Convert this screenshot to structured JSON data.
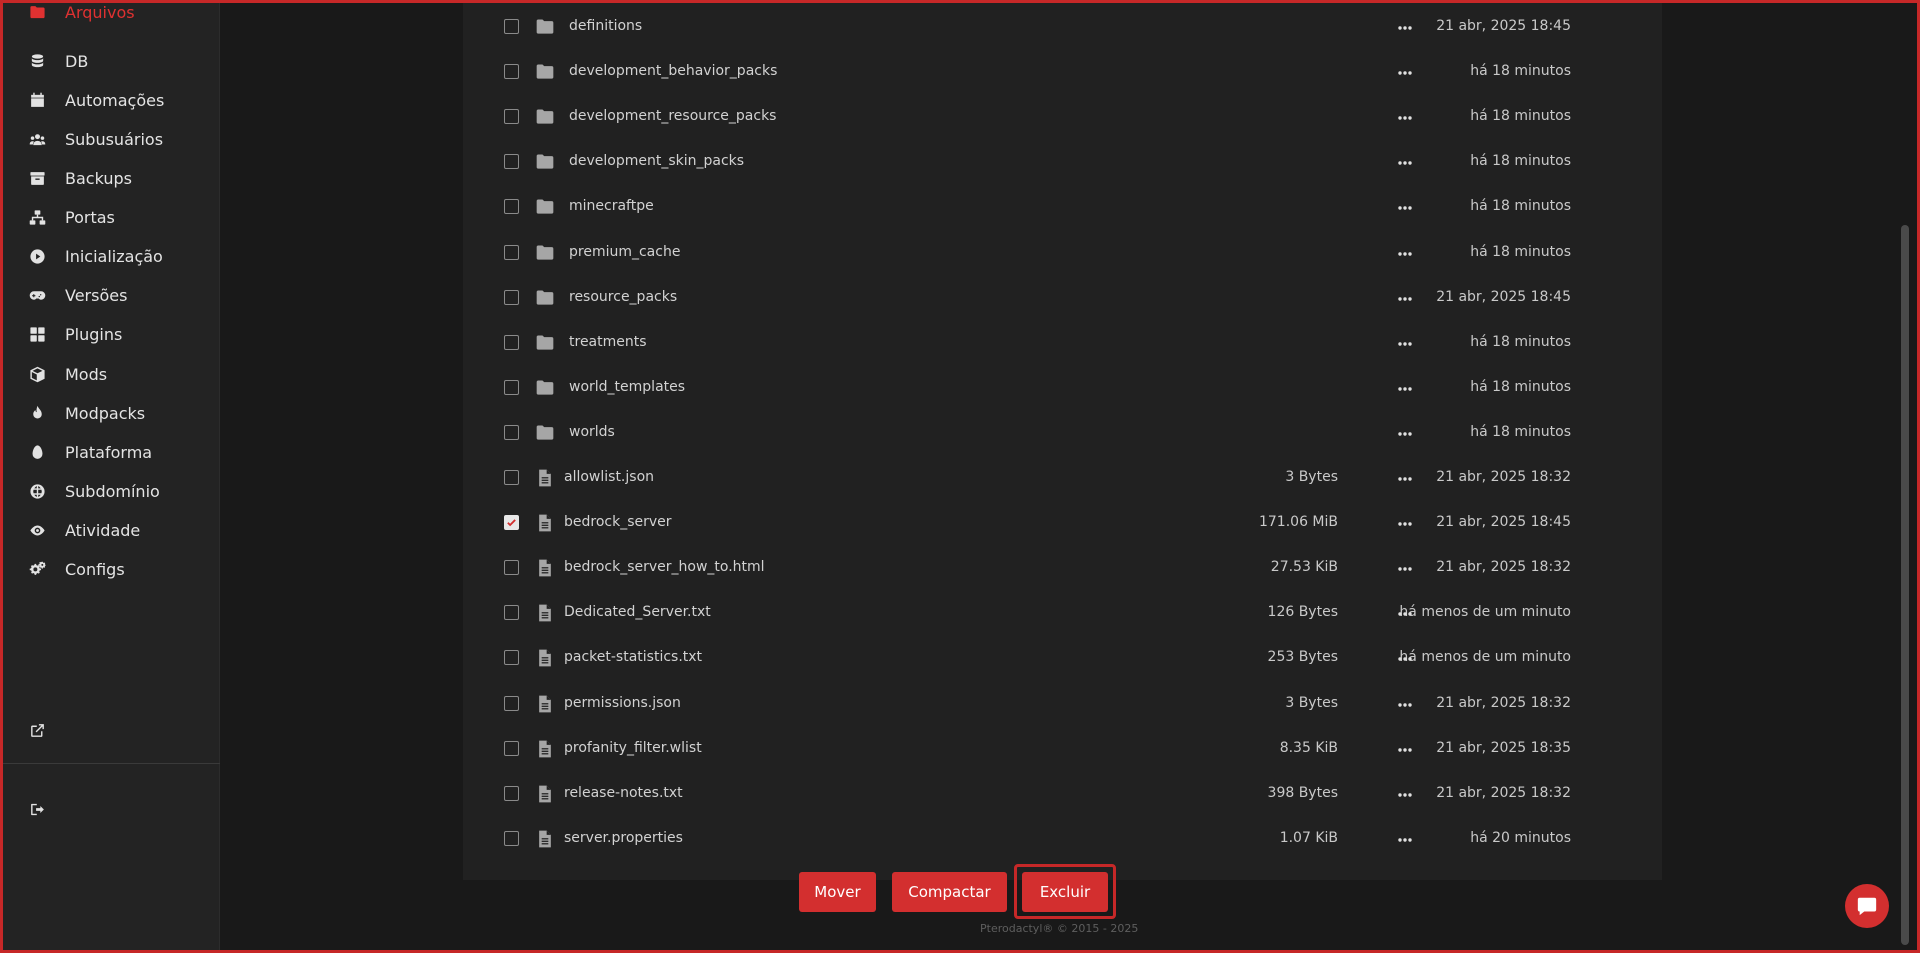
{
  "sidebar": {
    "active_item": "Arquivos",
    "items": [
      {
        "label": "Arquivos",
        "icon": "folder-icon"
      },
      {
        "label": "DB",
        "icon": "database-icon"
      },
      {
        "label": "Automações",
        "icon": "calendar-icon"
      },
      {
        "label": "Subusuários",
        "icon": "users-icon"
      },
      {
        "label": "Backups",
        "icon": "archive-icon"
      },
      {
        "label": "Portas",
        "icon": "network-icon"
      },
      {
        "label": "Inicialização",
        "icon": "play-circle-icon"
      },
      {
        "label": "Versões",
        "icon": "gamepad-icon"
      },
      {
        "label": "Plugins",
        "icon": "grid-icon"
      },
      {
        "label": "Mods",
        "icon": "cube-icon"
      },
      {
        "label": "Modpacks",
        "icon": "fire-icon"
      },
      {
        "label": "Plataforma",
        "icon": "egg-icon"
      },
      {
        "label": "Subdomínio",
        "icon": "globe-icon"
      },
      {
        "label": "Atividade",
        "icon": "eye-icon"
      },
      {
        "label": "Configs",
        "icon": "gears-icon"
      }
    ],
    "external_link_icon": "external-link-icon",
    "logout_icon": "sign-out-icon"
  },
  "files": [
    {
      "name": "definitions",
      "type": "folder",
      "size": "",
      "modified": "21 abr, 2025 18:45",
      "checked": false
    },
    {
      "name": "development_behavior_packs",
      "type": "folder",
      "size": "",
      "modified": "há 18 minutos",
      "checked": false
    },
    {
      "name": "development_resource_packs",
      "type": "folder",
      "size": "",
      "modified": "há 18 minutos",
      "checked": false
    },
    {
      "name": "development_skin_packs",
      "type": "folder",
      "size": "",
      "modified": "há 18 minutos",
      "checked": false
    },
    {
      "name": "minecraftpe",
      "type": "folder",
      "size": "",
      "modified": "há 18 minutos",
      "checked": false
    },
    {
      "name": "premium_cache",
      "type": "folder",
      "size": "",
      "modified": "há 18 minutos",
      "checked": false
    },
    {
      "name": "resource_packs",
      "type": "folder",
      "size": "",
      "modified": "21 abr, 2025 18:45",
      "checked": false
    },
    {
      "name": "treatments",
      "type": "folder",
      "size": "",
      "modified": "há 18 minutos",
      "checked": false
    },
    {
      "name": "world_templates",
      "type": "folder",
      "size": "",
      "modified": "há 18 minutos",
      "checked": false
    },
    {
      "name": "worlds",
      "type": "folder",
      "size": "",
      "modified": "há 18 minutos",
      "checked": false
    },
    {
      "name": "allowlist.json",
      "type": "file",
      "size": "3 Bytes",
      "modified": "21 abr, 2025 18:32",
      "checked": false
    },
    {
      "name": "bedrock_server",
      "type": "file",
      "size": "171.06 MiB",
      "modified": "21 abr, 2025 18:45",
      "checked": true
    },
    {
      "name": "bedrock_server_how_to.html",
      "type": "file",
      "size": "27.53 KiB",
      "modified": "21 abr, 2025 18:32",
      "checked": false
    },
    {
      "name": "Dedicated_Server.txt",
      "type": "file",
      "size": "126 Bytes",
      "modified": "há menos de um minuto",
      "checked": false
    },
    {
      "name": "packet-statistics.txt",
      "type": "file",
      "size": "253 Bytes",
      "modified": "há menos de um minuto",
      "checked": false
    },
    {
      "name": "permissions.json",
      "type": "file",
      "size": "3 Bytes",
      "modified": "21 abr, 2025 18:32",
      "checked": false
    },
    {
      "name": "profanity_filter.wlist",
      "type": "file",
      "size": "8.35 KiB",
      "modified": "21 abr, 2025 18:35",
      "checked": false
    },
    {
      "name": "release-notes.txt",
      "type": "file",
      "size": "398 Bytes",
      "modified": "21 abr, 2025 18:32",
      "checked": false
    },
    {
      "name": "server.properties",
      "type": "file",
      "size": "1.07 KiB",
      "modified": "há 20 minutos",
      "checked": false
    }
  ],
  "actions": {
    "move_label": "Mover",
    "compress_label": "Compactar",
    "delete_label": "Excluir"
  },
  "footer": {
    "text": "Pterodactyl® © 2015 - 2025"
  },
  "colors": {
    "accent": "#d32f2f",
    "background": "#191919",
    "panel": "#212121",
    "sidebar": "#232323"
  }
}
